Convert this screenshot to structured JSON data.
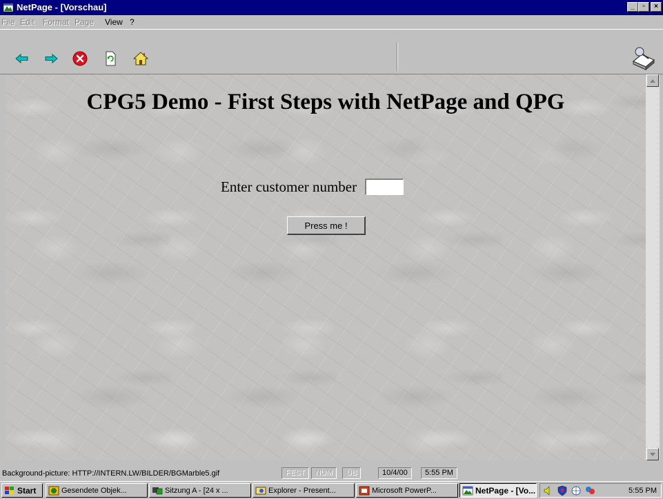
{
  "window": {
    "title": "NetPage - [Vorschau]",
    "controls": {
      "minimize": "_",
      "maximize": "▫",
      "close": "×"
    }
  },
  "menu": {
    "items": [
      {
        "label": "File",
        "enabled": false
      },
      {
        "label": "Edit",
        "enabled": false
      },
      {
        "label": "Format",
        "enabled": false
      },
      {
        "label": "Page",
        "enabled": false
      },
      {
        "label": "View",
        "enabled": true
      },
      {
        "label": "?",
        "enabled": true
      }
    ]
  },
  "toolbar": {
    "buttons": [
      "back-icon",
      "forward-icon",
      "stop-icon",
      "refresh-icon",
      "home-icon"
    ],
    "logo": "netpage-logo-icon"
  },
  "page": {
    "title": "CPG5 Demo - First Steps with NetPage and QPG",
    "form": {
      "label": "Enter customer number",
      "input_value": "",
      "button_label": "Press me !"
    }
  },
  "statusbar": {
    "text": "Background-picture: HTTP://INTERN.LW/BILDER/BGMarble5.gif",
    "indicators": [
      "FEST",
      "NUM",
      "ÜB"
    ],
    "date": "10/4/00",
    "time": "5:55 PM"
  },
  "taskbar": {
    "start_label": "Start",
    "tasks": [
      {
        "label": "Gesendete Objek...",
        "icon": "outlook-icon",
        "active": false
      },
      {
        "label": "Sitzung A - [24 x ...",
        "icon": "terminal-session-icon",
        "active": false
      },
      {
        "label": "Explorer - Present...",
        "icon": "explorer-icon",
        "active": false
      },
      {
        "label": "Microsoft PowerP...",
        "icon": "powerpoint-icon",
        "active": false
      },
      {
        "label": "NetPage - [Vo...",
        "icon": "netpage-icon",
        "active": true
      }
    ],
    "tray_icons": [
      "speaker-icon",
      "shield-icon",
      "network-icon",
      "messenger-icon"
    ],
    "clock": "5:55 PM"
  },
  "colors": {
    "titlebar": "#000080",
    "page_background": "#c4c2c0",
    "window": "#c0c0c0"
  }
}
